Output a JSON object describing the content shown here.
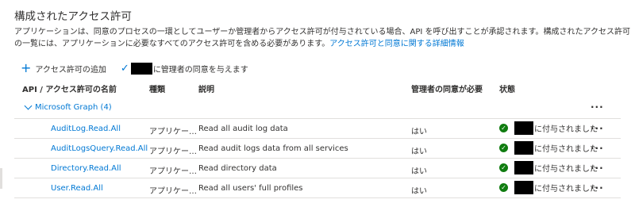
{
  "page": {
    "title": "構成されたアクセス許可",
    "description": "アプリケーションは、同意のプロセスの一環としてユーザーか管理者からアクセス許可が付与されている場合、API を呼び出すことが承認されます。構成されたアクセス許可の一覧には、アプリケーションに必要なすべてのアクセス許可を含める必要があります。",
    "description_link": "アクセス許可と同意に関する詳細情報"
  },
  "toolbar": {
    "add_label": "アクセス許可の追加",
    "grant_label": "に管理者の同意を与えます"
  },
  "table": {
    "headers": {
      "name": "API / アクセス許可の名前",
      "type": "種類",
      "description": "説明",
      "admin_consent": "管理者の同意が必要",
      "status": "状態"
    },
    "group": {
      "label": "Microsoft Graph (4)"
    },
    "more_glyph": "···",
    "rows": [
      {
        "name": "AuditLog.Read.All",
        "type": "アプリケー…",
        "description": "Read all audit log data",
        "admin_consent": "はい",
        "status": "に付与されました"
      },
      {
        "name": "AuditLogsQuery.Read.All",
        "type": "アプリケー…",
        "description": "Read audit logs data from all services",
        "admin_consent": "はい",
        "status": "に付与されました"
      },
      {
        "name": "Directory.Read.All",
        "type": "アプリケー…",
        "description": "Read directory data",
        "admin_consent": "はい",
        "status": "に付与されました"
      },
      {
        "name": "User.Read.All",
        "type": "アプリケー…",
        "description": "Read all users' full profiles",
        "admin_consent": "はい",
        "status": "に付与されました"
      }
    ]
  },
  "colors": {
    "accent": "#0078d4",
    "success": "#107c10",
    "divider": "#e1dfdd",
    "text": "#323130"
  }
}
